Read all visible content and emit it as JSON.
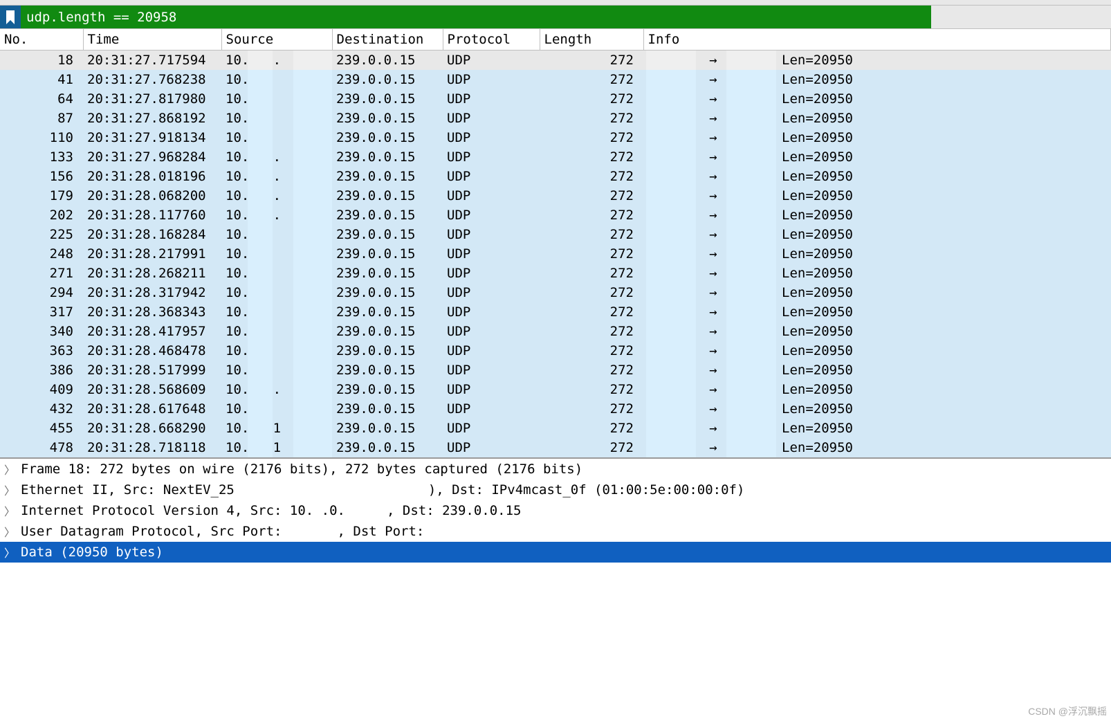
{
  "filter": {
    "expression": "udp.length == 20958"
  },
  "columns": {
    "no": "No.",
    "time": "Time",
    "source": "Source",
    "destination": "Destination",
    "protocol": "Protocol",
    "length": "Length",
    "info": "Info"
  },
  "packets": [
    {
      "no": 18,
      "time": "20:31:27.717594",
      "src_vis": "10.  .0.",
      "dst": "239.0.0.15",
      "proto": "UDP",
      "len": 272,
      "info_len": "Len=20950",
      "selected": true
    },
    {
      "no": 41,
      "time": "20:31:27.768238",
      "src_vis": "10.  .0",
      "dst": "239.0.0.15",
      "proto": "UDP",
      "len": 272,
      "info_len": "Len=20950"
    },
    {
      "no": 64,
      "time": "20:31:27.817980",
      "src_vis": "10.  .0",
      "dst": "239.0.0.15",
      "proto": "UDP",
      "len": 272,
      "info_len": "Len=20950"
    },
    {
      "no": 87,
      "time": "20:31:27.868192",
      "src_vis": "10.  .0",
      "dst": "239.0.0.15",
      "proto": "UDP",
      "len": 272,
      "info_len": "Len=20950"
    },
    {
      "no": 110,
      "time": "20:31:27.918134",
      "src_vis": "10.  .0",
      "dst": "239.0.0.15",
      "proto": "UDP",
      "len": 272,
      "info_len": "Len=20950"
    },
    {
      "no": 133,
      "time": "20:31:27.968284",
      "src_vis": "10.  .0.",
      "dst": "239.0.0.15",
      "proto": "UDP",
      "len": 272,
      "info_len": "Len=20950"
    },
    {
      "no": 156,
      "time": "20:31:28.018196",
      "src_vis": "10.  .0.",
      "dst": "239.0.0.15",
      "proto": "UDP",
      "len": 272,
      "info_len": "Len=20950"
    },
    {
      "no": 179,
      "time": "20:31:28.068200",
      "src_vis": "10.  .0.",
      "dst": "239.0.0.15",
      "proto": "UDP",
      "len": 272,
      "info_len": "Len=20950"
    },
    {
      "no": 202,
      "time": "20:31:28.117760",
      "src_vis": "10.  .0.",
      "dst": "239.0.0.15",
      "proto": "UDP",
      "len": 272,
      "info_len": "Len=20950"
    },
    {
      "no": 225,
      "time": "20:31:28.168284",
      "src_vis": "10.   0.",
      "dst": "239.0.0.15",
      "proto": "UDP",
      "len": 272,
      "info_len": "Len=20950"
    },
    {
      "no": 248,
      "time": "20:31:28.217991",
      "src_vis": "10.   0.",
      "dst": "239.0.0.15",
      "proto": "UDP",
      "len": 272,
      "info_len": "Len=20950"
    },
    {
      "no": 271,
      "time": "20:31:28.268211",
      "src_vis": "10.   0.",
      "dst": "239.0.0.15",
      "proto": "UDP",
      "len": 272,
      "info_len": "Len=20950"
    },
    {
      "no": 294,
      "time": "20:31:28.317942",
      "src_vis": "10.   0.",
      "dst": "239.0.0.15",
      "proto": "UDP",
      "len": 272,
      "info_len": "Len=20950"
    },
    {
      "no": 317,
      "time": "20:31:28.368343",
      "src_vis": "10.   0.",
      "dst": "239.0.0.15",
      "proto": "UDP",
      "len": 272,
      "info_len": "Len=20950"
    },
    {
      "no": 340,
      "time": "20:31:28.417957",
      "src_vis": "10.   0.",
      "dst": "239.0.0.15",
      "proto": "UDP",
      "len": 272,
      "info_len": "Len=20950"
    },
    {
      "no": 363,
      "time": "20:31:28.468478",
      "src_vis": "10.   0.",
      "dst": "239.0.0.15",
      "proto": "UDP",
      "len": 272,
      "info_len": "Len=20950"
    },
    {
      "no": 386,
      "time": "20:31:28.517999",
      "src_vis": "10.   0.",
      "dst": "239.0.0.15",
      "proto": "UDP",
      "len": 272,
      "info_len": "Len=20950"
    },
    {
      "no": 409,
      "time": "20:31:28.568609",
      "src_vis": "10.  .0.",
      "dst": "239.0.0.15",
      "proto": "UDP",
      "len": 272,
      "info_len": "Len=20950"
    },
    {
      "no": 432,
      "time": "20:31:28.617648",
      "src_vis": "10.   0.",
      "dst": "239.0.0.15",
      "proto": "UDP",
      "len": 272,
      "info_len": "Len=20950"
    },
    {
      "no": 455,
      "time": "20:31:28.668290",
      "src_vis": "10.   0.1",
      "dst": "239.0.0.15",
      "proto": "UDP",
      "len": 272,
      "info_len": "Len=20950"
    },
    {
      "no": 478,
      "time": "20:31:28.718118",
      "src_vis": "10.   0.1",
      "dst": "239.0.0.15",
      "proto": "UDP",
      "len": 272,
      "info_len": "Len=20950"
    }
  ],
  "details": {
    "frame": "Frame 18: 272 bytes on wire (2176 bits), 272 bytes captured (2176 bits)",
    "eth_pre": "Ethernet II, Src: NextEV_25",
    "eth_post": "), Dst: IPv4mcast_0f (01:00:5e:00:00:0f)",
    "ip_pre": "Internet Protocol Version 4, Src: 10.  .0.",
    "ip_post": ", Dst: 239.0.0.15",
    "udp_pre": "User Datagram Protocol, Src Port:",
    "udp_mid": ", Dst Port:",
    "data": "Data (20950 bytes)"
  },
  "watermark": "CSDN @浮沉飘摇"
}
